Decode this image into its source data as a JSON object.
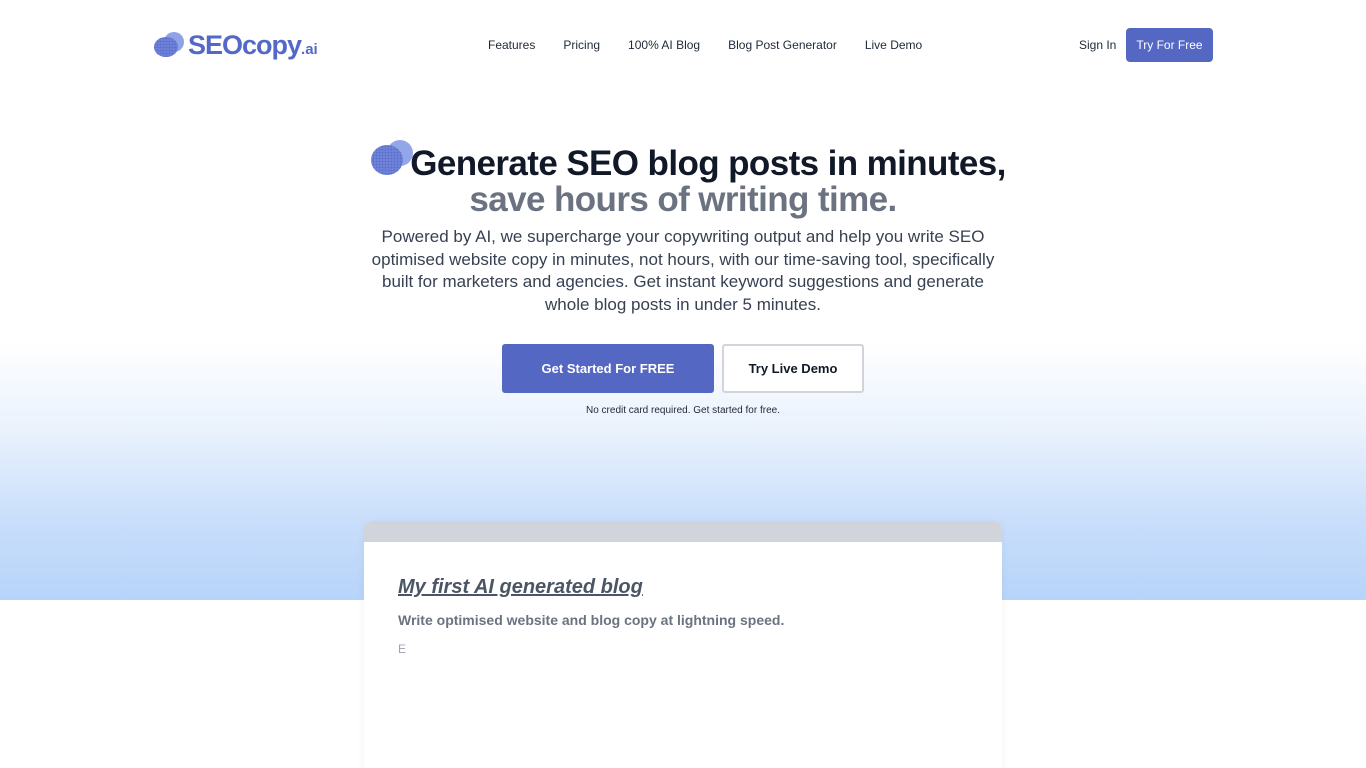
{
  "brand": {
    "logo_main": "SEOcopy",
    "logo_suffix": ".ai",
    "accent": "#5468c3"
  },
  "nav": {
    "links": [
      "Features",
      "Pricing",
      "100% AI Blog",
      "Blog Post Generator",
      "Live Demo"
    ],
    "sign_in": "Sign In",
    "try_free": "Try For Free"
  },
  "hero": {
    "headline_line1": "Generate SEO blog posts in minutes,",
    "headline_line2": "save hours of writing time.",
    "description": "Powered by AI, we supercharge your copywriting output and help you write SEO optimised website copy in minutes, not hours, with our time-saving tool, specifically built for marketers and agencies. Get instant keyword suggestions and generate whole blog posts in under 5 minutes.",
    "cta_primary": "Get Started For FREE",
    "cta_secondary": "Try Live Demo",
    "note": "No credit card required. Get started for free."
  },
  "demo": {
    "title": "My first AI generated blog",
    "subtitle": "Write optimised website and blog copy at lightning speed.",
    "typed": "E"
  }
}
